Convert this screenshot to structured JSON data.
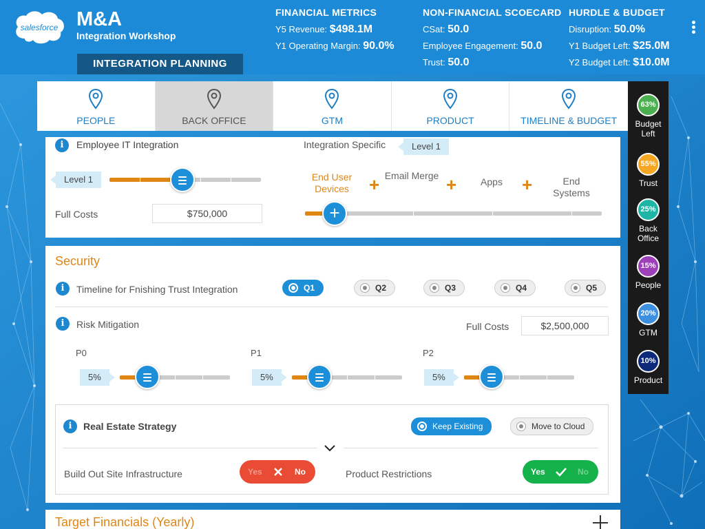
{
  "header": {
    "brand": "salesforce",
    "title": "M&A",
    "subtitle": "Integration Workshop",
    "banner": "INTEGRATION PLANNING",
    "financial": {
      "heading": "FINANCIAL METRICS",
      "rows": [
        {
          "label": "Y5 Revenue:",
          "value": "$498.1M"
        },
        {
          "label": "Y1 Operating Margin:",
          "value": "90.0%"
        }
      ]
    },
    "nonfinancial": {
      "heading": "NON-FINANCIAL SCOECARD",
      "rows": [
        {
          "label": "CSat:",
          "value": "50.0"
        },
        {
          "label": "Employee Engagement:",
          "value": "50.0"
        },
        {
          "label": "Trust:",
          "value": "50.0"
        }
      ]
    },
    "hurdle": {
      "heading": "HURDLE & BUDGET",
      "rows": [
        {
          "label": "Disruption:",
          "value": "50.0%"
        },
        {
          "label": "Y1 Budget Left:",
          "value": "$25.0M"
        },
        {
          "label": "Y2 Budget Left:",
          "value": "$10.0M"
        }
      ]
    }
  },
  "tabs": [
    {
      "label": "PEOPLE",
      "active": false
    },
    {
      "label": "BACK OFFICE",
      "active": true
    },
    {
      "label": "GTM",
      "active": false
    },
    {
      "label": "PRODUCT",
      "active": false
    },
    {
      "label": "TIMELINE & BUDGET",
      "active": false
    }
  ],
  "sidebar": [
    {
      "pct": "63%",
      "label": "Budget Left",
      "color": "#4caf50"
    },
    {
      "pct": "55%",
      "label": "Trust",
      "color": "#f5a623"
    },
    {
      "pct": "25%",
      "label": "Back Office",
      "color": "#1fb5a5"
    },
    {
      "pct": "15%",
      "label": "People",
      "color": "#9c3fb8"
    },
    {
      "pct": "20%",
      "label": "GTM",
      "color": "#3d8fe0"
    },
    {
      "pct": "10%",
      "label": "Product",
      "color": "#0d2a7a"
    }
  ],
  "it": {
    "title": "Employee IT Integration",
    "level": "Level 1",
    "slider_level": 0.48,
    "full_costs_label": "Full Costs",
    "full_costs": "$750,000",
    "specific_title": "Integration Specific",
    "specific_level": "Level 1",
    "options": [
      "End User Devices",
      "Email Merge",
      "Apps",
      "End Systems"
    ],
    "selected_option": "End User Devices",
    "specific_slider_level": 0.1
  },
  "security": {
    "title": "Security",
    "timeline_label": "Timeline for Fnishing Trust Integration",
    "quarters": [
      "Q1",
      "Q2",
      "Q3",
      "Q4",
      "Q5"
    ],
    "selected_quarter": "Q1",
    "risk_label": "Risk Mitigation",
    "full_costs_label": "Full Costs",
    "full_costs": "$2,500,000",
    "priorities": [
      {
        "name": "P0",
        "value": "5%",
        "level": 0.25
      },
      {
        "name": "P1",
        "value": "5%",
        "level": 0.25
      },
      {
        "name": "P2",
        "value": "5%",
        "level": 0.25
      }
    ],
    "real_estate": {
      "label": "Real Estate Strategy",
      "options": [
        "Keep Existing",
        "Move to Cloud"
      ],
      "selected": "Keep Existing",
      "build_label": "Build Out Site Infrastructure",
      "build_toggle": {
        "yes": "Yes",
        "no": "No",
        "value": "No"
      },
      "product_label": "Product Restrictions",
      "product_toggle": {
        "yes": "Yes",
        "no": "No",
        "value": "Yes"
      }
    }
  },
  "target": {
    "title": "Target Financials (Yearly)"
  }
}
